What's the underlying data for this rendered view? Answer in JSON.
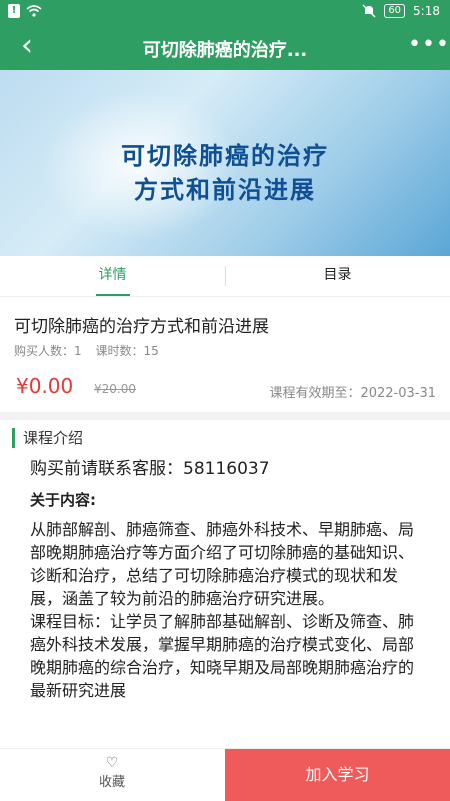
{
  "status_bar": {
    "time": "5:18",
    "battery": "60"
  },
  "nav": {
    "title": "可切除肺癌的治疗...",
    "more": "•••"
  },
  "banner": {
    "line1": "可切除肺癌的治疗",
    "line2": "方式和前沿进展"
  },
  "tabs": [
    {
      "label": "详情"
    },
    {
      "label": "目录"
    }
  ],
  "course": {
    "title": "可切除肺癌的治疗方式和前沿进展",
    "buyers": "购买人数：1",
    "lessons": "课时数：15",
    "price": "¥0.00",
    "original_price": "¥20.00",
    "validity": "课程有效期至：2022-03-31"
  },
  "intro": {
    "heading": "课程介绍",
    "contact": "购买前请联系客服：58116037",
    "about_label": "关于内容:",
    "paragraph1": "从肺部解剖、肺癌筛查、肺癌外科技术、早期肺癌、局部晚期肺癌治疗等方面介绍了可切除肺癌的基础知识、诊断和治疗，总结了可切除肺癌治疗模式的现状和发展，涵盖了较为前沿的肺癌治疗研究进展。",
    "paragraph2": "课程目标：让学员了解肺部基础解剖、诊断及筛查、肺癌外科技术发展，掌握早期肺癌的治疗模式变化、局部晚期肺癌的综合治疗，知晓早期及局部晚期肺癌治疗的最新研究进展"
  },
  "bottom_bar": {
    "favorite_label": "收藏",
    "join_label": "加入学习"
  }
}
